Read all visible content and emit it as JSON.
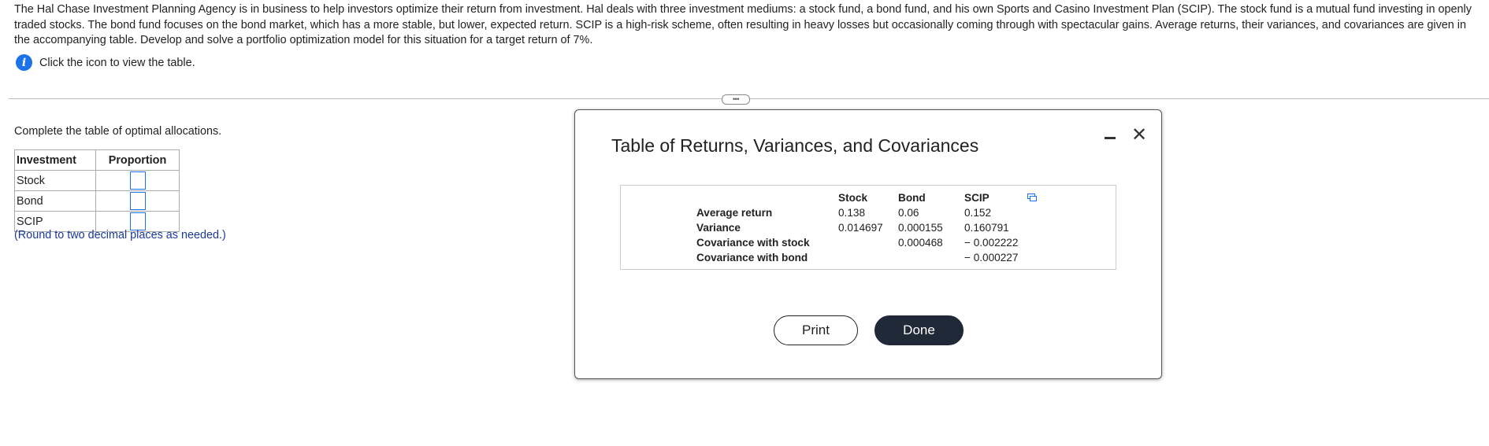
{
  "problem": {
    "text": "The Hal Chase Investment Planning Agency is in business to help investors optimize their return from investment. Hal deals with three investment mediums: a stock fund, a bond fund, and his own Sports and Casino Investment Plan (SCIP). The stock fund is a mutual fund investing in openly traded stocks. The bond fund focuses on the bond market, which has a more stable, but lower, expected return. SCIP is a high-risk scheme, often resulting in heavy losses but occasionally coming through with spectacular gains. Average returns, their variances, and covariances are given in the accompanying table. Develop and solve a portfolio optimization model for this situation for a target return of 7%.",
    "info_icon_glyph": "i",
    "info_text": "Click the icon to view the table."
  },
  "expander_glyph": "•••",
  "answer": {
    "prompt": "Complete the table of optimal allocations.",
    "headers": [
      "Investment",
      "Proportion"
    ],
    "rows": [
      {
        "name": "Stock",
        "value": ""
      },
      {
        "name": "Bond",
        "value": ""
      },
      {
        "name": "SCIP",
        "value": ""
      }
    ],
    "hint": "(Round to two decimal places as needed.)"
  },
  "dialog": {
    "title": "Table of Returns, Variances, and Covariances",
    "columns": [
      "Stock",
      "Bond",
      "SCIP"
    ],
    "rows": [
      {
        "label": "Average return",
        "stock": "0.138",
        "bond": "0.06",
        "scip": "0.152"
      },
      {
        "label": "Variance",
        "stock": "0.014697",
        "bond": "0.000155",
        "scip": "0.160791"
      },
      {
        "label": "Covariance with stock",
        "stock": "",
        "bond": "0.000468",
        "scip": "− 0.002222"
      },
      {
        "label": "Covariance with bond",
        "stock": "",
        "bond": "",
        "scip": "− 0.000227"
      }
    ],
    "print_label": "Print",
    "done_label": "Done",
    "close_glyph": "✕",
    "accent_color": "#1a73e8",
    "done_color": "#1f2937"
  }
}
